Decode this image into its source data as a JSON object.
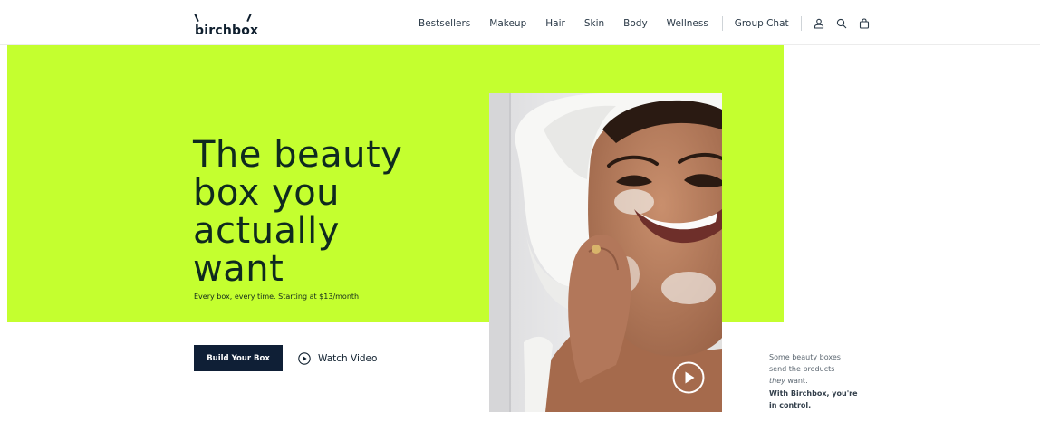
{
  "brand": {
    "name": "birchbox"
  },
  "nav": {
    "items": [
      "Bestsellers",
      "Makeup",
      "Hair",
      "Skin",
      "Body",
      "Wellness"
    ],
    "group_chat": "Group Chat",
    "icons": [
      "user-icon",
      "search-icon",
      "bag-icon"
    ]
  },
  "hero": {
    "headline_lines": [
      "The beauty",
      "box you",
      "actually",
      "want"
    ],
    "subline": "Every box, every time. Starting at $13/month",
    "build_button": "Build Your Box",
    "watch_label": "Watch Video",
    "accent_color": "#c4ff2f",
    "button_color": "#0f1f36"
  },
  "side_copy": {
    "line1": "Some beauty boxes",
    "line2": "send the products",
    "line3_em": "they",
    "line3_rest": " want.",
    "line4": "With Birchbox, you're",
    "line5": "in control."
  }
}
